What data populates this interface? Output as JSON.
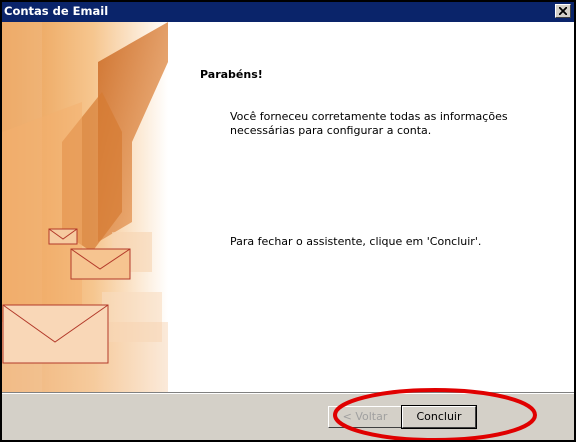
{
  "window": {
    "title": "Contas de Email"
  },
  "main": {
    "heading": "Parabéns!",
    "message": "Você forneceu corretamente todas as informações necessárias para configurar a conta.",
    "instruction": "Para fechar o assistente, clique em 'Concluir'."
  },
  "buttons": {
    "back_label": "< Voltar",
    "finish_label": "Concluir"
  },
  "icons": {
    "close": "close-icon",
    "side_banner": "email-envelopes-banner"
  },
  "colors": {
    "titlebar": "#0a246a",
    "annotation_circle": "#e00000"
  }
}
